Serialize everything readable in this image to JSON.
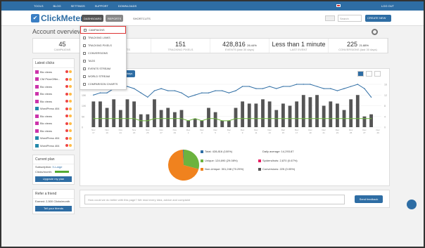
{
  "topnav": [
    "TOOLS",
    "BLOG",
    "SETTINGS",
    "SUPPORT",
    "DOWNLOADS"
  ],
  "logout": "LOG OUT",
  "logo": "ClickMeter",
  "header": {
    "dashboard": "DASHBOARD",
    "reports": "REPORTS",
    "shortcuts": "SHORTCUTS",
    "search_placeholder": "Search",
    "new_button": "CREATE NEW"
  },
  "page_title": "Account overview",
  "stats": [
    {
      "n": "45",
      "l": "CAMPAIGNS"
    },
    {
      "n": "7",
      "l": "DATAPOINTS"
    },
    {
      "n": "151",
      "l": "TRACKING PIXELS"
    },
    {
      "n": "428,816",
      "pct": "26.44%",
      "l": "EVENTS (last 30 days)"
    },
    {
      "n": "Less than 1 minute",
      "l": "LAST EVENT"
    },
    {
      "n": "225",
      "pct": "21.88%",
      "l": "CONVERSIONS (last 30 days)"
    }
  ],
  "menu": [
    "CAMPAIGNS",
    "TRACKING LINKS",
    "TRACKING PIXELS",
    "CONVERSIONS",
    "TAGS",
    "EVENTS STREAM",
    "WORLD STREAM",
    "COMPARISON CHARTS"
  ],
  "latest_clicks_title": "Latest clicks",
  "latest_clicks": [
    "Bio views",
    "CM PrizeOffer...",
    "Bio views",
    "Bio views",
    "Bio views",
    "WordPress 404",
    "Bio views",
    "Bio views",
    "Bio views",
    "WordPress 404",
    "WordPress 404"
  ],
  "plan": {
    "title": "Current plan",
    "sub_label": "Subscription:",
    "sub_value": "X-Large",
    "clicks_label": "Clicks/month:",
    "upgrade": "Upgrade my plan"
  },
  "refer": {
    "title": "Refer a friend",
    "earned": "Earned: 2,500 Clicks/month",
    "tell": "Tell your friends"
  },
  "days_button": "days",
  "legend": {
    "total": "Total: 428,816 (100%)",
    "unique": "Unique: 124,690 (29.08%)",
    "nonunique": "Non-Unique: 301,248 (70.25%)",
    "daily": "Daily average: 14,293.87",
    "spiders": "Spiders/bots: 2,870 (0.67%)",
    "conversions": "Conversions: 225 (0.05%)"
  },
  "chart_data": {
    "type": "bar",
    "categories": [
      "Nov 17",
      "",
      "Nov 19",
      "",
      "Nov 21",
      "",
      "Nov 23",
      "",
      "Nov 25",
      "",
      "Nov 27",
      "",
      "Nov 29",
      "",
      "Dec 1",
      "",
      "Dec 3",
      "",
      "Dec 5",
      "",
      "Dec 7",
      "",
      "Dec 9",
      "",
      "Dec 11",
      "",
      "Dec 13",
      "",
      "Dec 15",
      "",
      "Dec 17",
      "",
      "Dec 19",
      "",
      "Dec 21",
      "",
      "Dec 23",
      "",
      "Dec 25",
      "",
      "Dec 27",
      "",
      "Dec 29"
    ],
    "series": [
      {
        "name": "Total",
        "values": [
          12,
          12,
          9,
          13,
          8,
          13,
          12,
          6,
          6,
          13,
          8,
          9,
          7,
          8,
          3,
          4,
          3,
          9,
          7,
          3,
          3,
          9,
          12,
          11,
          11,
          13,
          12,
          8,
          11,
          10,
          12,
          15,
          14,
          15,
          10,
          12,
          11,
          8,
          13,
          15,
          5,
          6
        ]
      },
      {
        "name": "Unique",
        "values": [
          4,
          4,
          4,
          4,
          4,
          4,
          4,
          3,
          3,
          4,
          4,
          4,
          4,
          4,
          3,
          4,
          3,
          4,
          4,
          3,
          3,
          4,
          4,
          4,
          4,
          4,
          4,
          4,
          4,
          4,
          4,
          4,
          4,
          4,
          4,
          4,
          4,
          4,
          4,
          4,
          4,
          4
        ]
      },
      {
        "name": "Daily",
        "values": [
          15,
          16,
          16,
          18,
          19,
          19,
          18,
          16,
          14,
          17,
          18,
          17,
          17,
          16,
          14,
          15,
          16,
          16,
          17,
          17,
          16,
          17,
          19,
          19,
          18,
          18,
          19,
          18,
          19,
          19,
          20,
          20,
          20,
          19,
          18,
          18,
          17,
          18,
          19,
          20,
          18,
          14
        ]
      }
    ],
    "ylim": [
      0,
      20
    ],
    "yticks_left": [
      "0",
      "5K",
      "10K",
      "15K",
      "20K"
    ],
    "yticks_right": [
      "0",
      "4",
      "8",
      "12",
      "16"
    ],
    "pie": [
      {
        "name": "Unique",
        "value": 29.08,
        "color": "#6cb33e"
      },
      {
        "name": "Non-Unique",
        "value": 70.25,
        "color": "#f0821e"
      },
      {
        "name": "Spiders",
        "value": 0.67,
        "color": "#2e6da4"
      }
    ]
  },
  "feedback": {
    "placeholder": "How could we do better with this page? We read every idea, advice and complaint",
    "button": "Send feedback"
  }
}
